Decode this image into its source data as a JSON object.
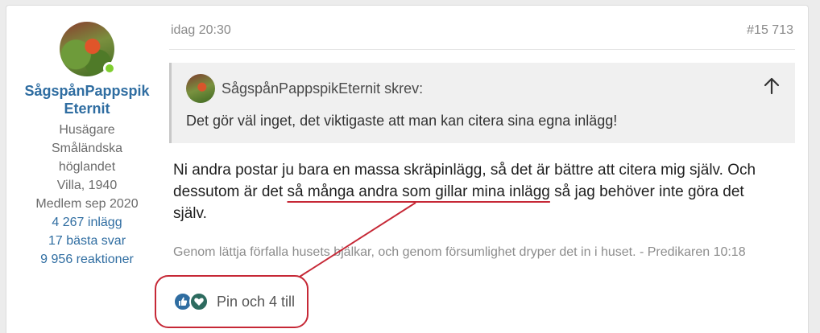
{
  "user": {
    "username": "SågspånPappspikEternit",
    "role": "Husägare",
    "location": "Småländska höglandet",
    "house": "Villa, 1940",
    "member_since": "Medlem sep 2020",
    "posts": "4 267 inlägg",
    "best_answers": "17 bästa svar",
    "reactions": "9 956 reaktioner"
  },
  "post": {
    "time": "idag 20:30",
    "number": "#15 713",
    "quote": {
      "author_line": "SågspånPappspikEternit skrev:",
      "text": "Det gör väl inget, det viktigaste att man kan citera sina egna inlägg!"
    },
    "message_part1": "Ni andra postar ju bara en massa skräpinlägg, så det är bättre att citera mig själv. Och dessutom är det ",
    "message_highlight": "så många andra som gillar mina inlägg",
    "message_part2": " så jag behöver inte göra det själv.",
    "signature": "Genom lättja förfalla husets bjälkar, och genom försumlighet dryper det in i huset. - Predikaren 10:18",
    "reactions_text": "Pin och 4 till"
  },
  "colors": {
    "link": "#2f6da1",
    "online": "#7fce2f",
    "annotation": "#c62836",
    "quote_bg": "#f0f0f0"
  },
  "icons": [
    "online-status-icon",
    "quote-arrow-up-icon",
    "like-reaction-icon",
    "love-reaction-icon"
  ]
}
